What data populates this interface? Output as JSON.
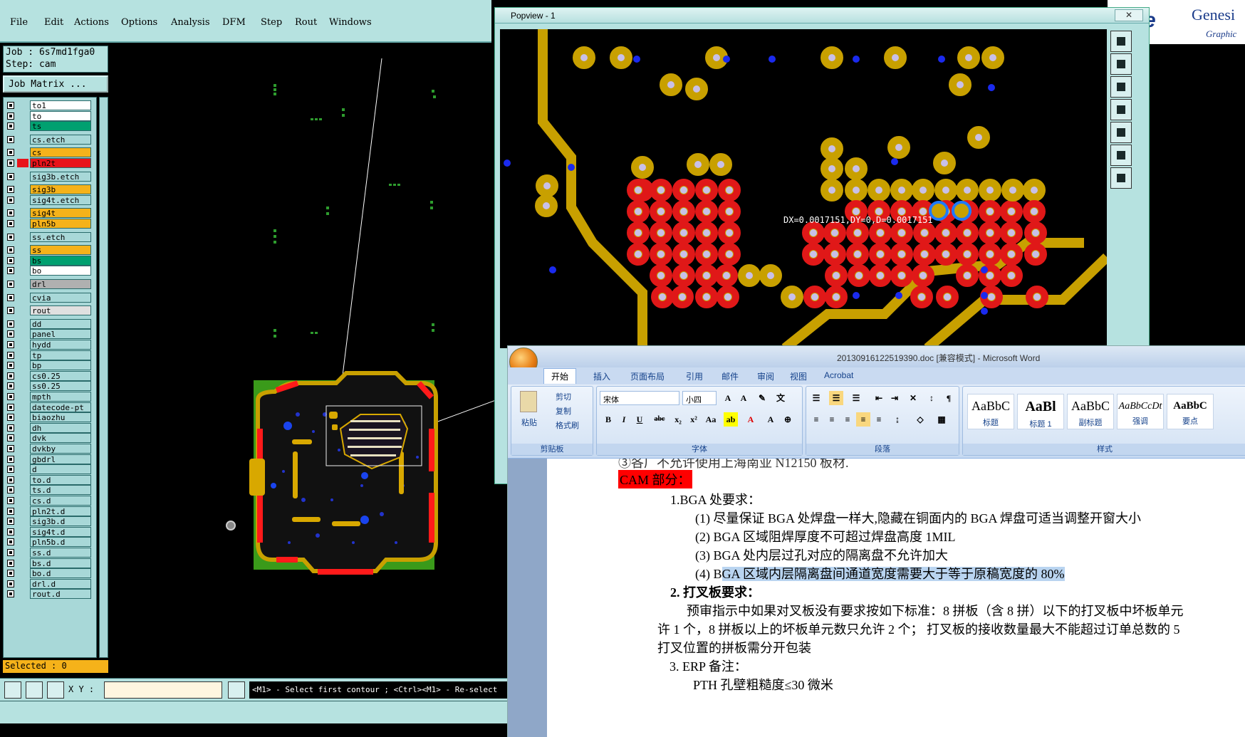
{
  "genesis": {
    "menu": [
      "File",
      "Edit",
      "Actions",
      "Options",
      "Analysis",
      "DFM",
      "Step",
      "Rout",
      "Windows"
    ],
    "job_label": "Job : 6s7md1fga0",
    "step_label": "Step: cam",
    "job_matrix_button": "Job Matrix ...",
    "layers": [
      {
        "name": "to1",
        "color": "#ffffff"
      },
      {
        "name": "to",
        "color": "#ffffff"
      },
      {
        "name": "ts",
        "color": "#00a070"
      },
      {
        "name": "cs.etch",
        "color": "#a8d8d8"
      },
      {
        "name": "cs",
        "color": "#f5b21a"
      },
      {
        "name": "pln2t",
        "color": "#e8131a"
      },
      {
        "name": "sig3b.etch",
        "color": "#a8d8d8"
      },
      {
        "name": "sig3b",
        "color": "#f5b21a"
      },
      {
        "name": "sig4t.etch",
        "color": "#a8d8d8"
      },
      {
        "name": "sig4t",
        "color": "#f5b21a"
      },
      {
        "name": "pln5b",
        "color": "#f5b21a"
      },
      {
        "name": "ss.etch",
        "color": "#a8d8d8"
      },
      {
        "name": "ss",
        "color": "#f5b21a"
      },
      {
        "name": "bs",
        "color": "#00a070"
      },
      {
        "name": "bo",
        "color": "#ffffff"
      },
      {
        "name": "drl",
        "color": "#b0b0b0"
      },
      {
        "name": "cvia",
        "color": "#a8d8d8"
      },
      {
        "name": "rout",
        "color": "#e0e0e0"
      },
      {
        "name": "dd",
        "color": "#a8d8d8"
      },
      {
        "name": "panel",
        "color": "#a8d8d8"
      },
      {
        "name": "hydd",
        "color": "#a8d8d8"
      },
      {
        "name": "tp",
        "color": "#a8d8d8"
      },
      {
        "name": "bp",
        "color": "#a8d8d8"
      },
      {
        "name": "cs0.25",
        "color": "#a8d8d8"
      },
      {
        "name": "ss0.25",
        "color": "#a8d8d8"
      },
      {
        "name": "mpth",
        "color": "#a8d8d8"
      },
      {
        "name": "datecode-pt",
        "color": "#a8d8d8"
      },
      {
        "name": "biaozhu",
        "color": "#a8d8d8"
      },
      {
        "name": "dh",
        "color": "#a8d8d8"
      },
      {
        "name": "dvk",
        "color": "#a8d8d8"
      },
      {
        "name": "dvkby",
        "color": "#a8d8d8"
      },
      {
        "name": "gbdrl",
        "color": "#a8d8d8"
      },
      {
        "name": "d",
        "color": "#a8d8d8"
      },
      {
        "name": "to.d",
        "color": "#a8d8d8"
      },
      {
        "name": "ts.d",
        "color": "#a8d8d8"
      },
      {
        "name": "cs.d",
        "color": "#a8d8d8"
      },
      {
        "name": "pln2t.d",
        "color": "#a8d8d8"
      },
      {
        "name": "sig3b.d",
        "color": "#a8d8d8"
      },
      {
        "name": "sig4t.d",
        "color": "#a8d8d8"
      },
      {
        "name": "pln5b.d",
        "color": "#a8d8d8"
      },
      {
        "name": "ss.d",
        "color": "#a8d8d8"
      },
      {
        "name": "bs.d",
        "color": "#a8d8d8"
      },
      {
        "name": "bo.d",
        "color": "#a8d8d8"
      },
      {
        "name": "drl.d",
        "color": "#a8d8d8"
      },
      {
        "name": "rout.d",
        "color": "#a8d8d8"
      }
    ],
    "selected": "Selected : 0",
    "xy_label": "X Y :",
    "status_message": "<M1> - Select first contour ; <Ctrl><M1> - Re-select"
  },
  "popview": {
    "title": "Popview - 1",
    "close": "✕",
    "measure_readout": "DX=0.0017151,DY=0,D=0.0017151"
  },
  "logo": {
    "line1": "tline",
    "line2": "Genesi",
    "line3": "Graphic"
  },
  "word": {
    "title": "20130916122519390.doc [兼容模式] - Microsoft Word",
    "tabs": [
      "开始",
      "插入",
      "页面布局",
      "引用",
      "邮件",
      "审阅",
      "视图",
      "Acrobat"
    ],
    "clipboard": {
      "paste": "粘贴",
      "cut": "剪切",
      "copy": "复制",
      "format_painter": "格式刷",
      "group": "剪贴板"
    },
    "font": {
      "name": "宋体",
      "size": "小四",
      "group": "字体"
    },
    "paragraph_group": "段落",
    "styles": [
      {
        "preview": "AaBbC",
        "name": "标题"
      },
      {
        "preview": "AaBl",
        "name": "标题 1"
      },
      {
        "preview": "AaBbC",
        "name": "副标题"
      },
      {
        "preview": "AaBbCcDt",
        "name": "强调"
      },
      {
        "preview": "AaBbC",
        "name": "要点"
      }
    ],
    "styles_group": "样式",
    "doc": {
      "l0": "③各厂不允许使用上海南亚 N12150 板材.",
      "cam": "CAM 部分：",
      "h1": "1.BGA 处要求：",
      "i1": "(1) 尽量保证 BGA 处焊盘一样大,隐藏在铜面内的 BGA 焊盘可适当调整开窗大小",
      "i2": "(2) BGA 区域阻焊厚度不可超过焊盘高度 1MIL",
      "i3": "(3) BGA 处内层过孔对应的隔离盘不允许加大",
      "i4a": "(4) B",
      "i4b": "GA 区域内层隔离盘间通道宽度需要大于等于原稿宽度的 80%",
      "h2": "2. 打叉板要求：",
      "p1": "预审指示中如果对叉板没有要求按如下标准：8 拼板（含 8 拼）以下的打叉板中坏板单元",
      "p2": "许 1 个，8 拼板以上的坏板单元数只允许 2 个；  打叉板的接收数量最大不能超过订单总数的 5",
      "p3": "打叉位置的拼板需分开包装",
      "h3": "3. ERP 备注：",
      "p4": "PTH 孔壁粗糙度≤30 微米"
    }
  }
}
